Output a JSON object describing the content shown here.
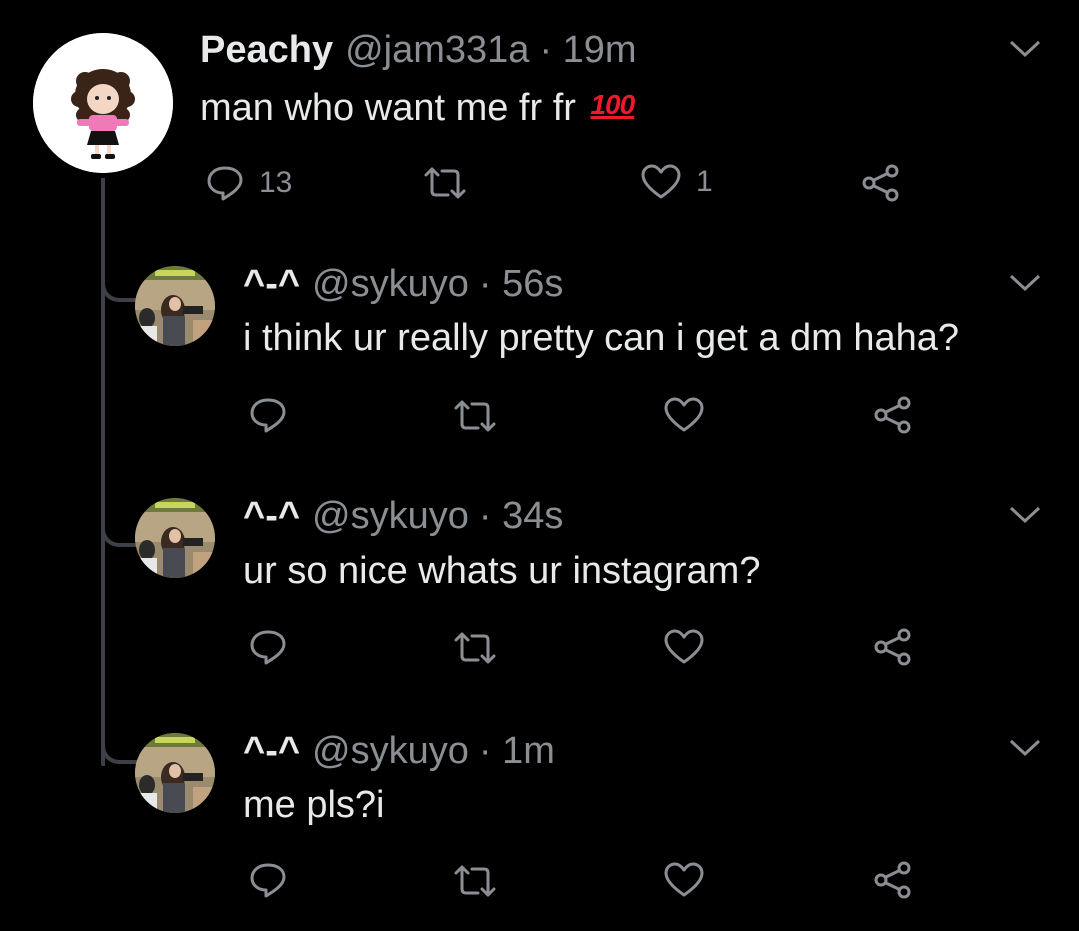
{
  "original_tweet": {
    "display_name": "Peachy",
    "handle": "@jam331a",
    "time": "· 19m",
    "text": "man who want me fr fr",
    "emoji": "100",
    "reply_count": "13",
    "like_count": "1",
    "avatar": "cartoon-girl-avatar"
  },
  "replies": [
    {
      "display_name": "^-^",
      "handle": "@sykuyo",
      "time": "· 56s",
      "text": "i think ur really pretty can i get a dm haha?",
      "avatar": "photo-avatar"
    },
    {
      "display_name": "^-^",
      "handle": "@sykuyo",
      "time": "· 34s",
      "text": "ur so nice whats ur instagram?",
      "avatar": "photo-avatar"
    },
    {
      "display_name": "^-^",
      "handle": "@sykuyo",
      "time": "· 1m",
      "text": "me pls?i",
      "avatar": "photo-avatar"
    }
  ],
  "icons": {
    "reply": "reply-icon",
    "retweet": "retweet-icon",
    "like": "heart-icon",
    "share": "share-icon",
    "menu": "chevron-down-icon"
  },
  "colors": {
    "background": "#000000",
    "primary_text": "#e7e9ea",
    "secondary_text": "#8b8f94",
    "thread_line": "#3d4147",
    "emoji_red": "#f0192b"
  }
}
